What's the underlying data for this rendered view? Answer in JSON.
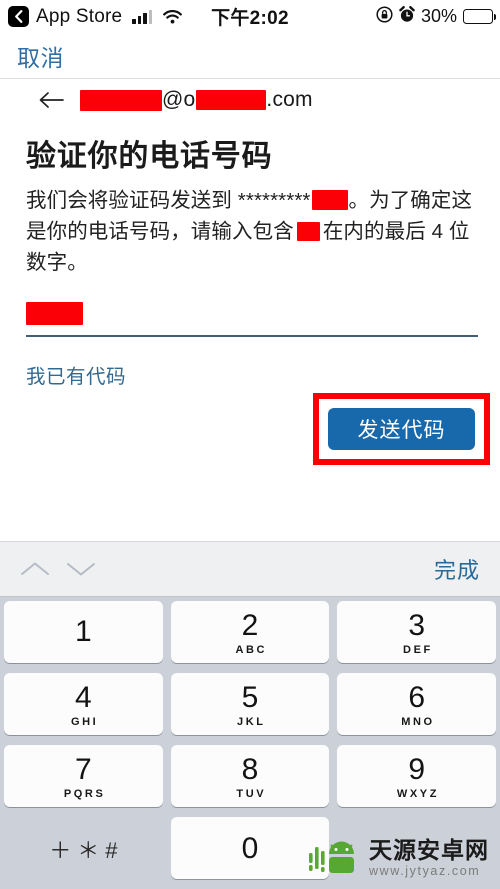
{
  "statusbar": {
    "back_icon": "chevron-left-icon",
    "carrier_app": "App Store",
    "signal_icon": "cellular-signal-icon",
    "wifi_icon": "wifi-icon",
    "time": "下午2:02",
    "rotation_lock_icon": "rotation-lock-icon",
    "alarm_icon": "alarm-clock-icon",
    "battery_percent": "30%",
    "battery_icon": "battery-icon",
    "battery_level": 30
  },
  "navbar": {
    "cancel_label": "取消"
  },
  "account": {
    "back_icon": "arrow-left-icon",
    "email_at": "@",
    "email_domain_visible": "o",
    "email_tld": ".com",
    "redaction_color": "#fb0007"
  },
  "page": {
    "title": "验证你的电话号码",
    "body_part1": "我们会将验证码发送到 *********",
    "body_part2": "。为了确定这是你的电话号码，请输入包含",
    "body_part3": "在内的最后 4 位数字。"
  },
  "field": {
    "name": "phone-last4-input",
    "value": "",
    "placeholder": ""
  },
  "links": {
    "have_code": "我已有代码"
  },
  "primary_button": {
    "label": "发送代码",
    "color": "#1769ac",
    "highlight_color": "#fb0007"
  },
  "keyboard": {
    "toolbar": {
      "prev_icon": "chevron-up-icon",
      "next_icon": "chevron-down-icon",
      "done_label": "完成"
    },
    "keys": [
      {
        "num": "1",
        "sub": ""
      },
      {
        "num": "2",
        "sub": "ABC"
      },
      {
        "num": "3",
        "sub": "DEF"
      },
      {
        "num": "4",
        "sub": "GHI"
      },
      {
        "num": "5",
        "sub": "JKL"
      },
      {
        "num": "6",
        "sub": "MNO"
      },
      {
        "num": "7",
        "sub": "PQRS"
      },
      {
        "num": "8",
        "sub": "TUV"
      },
      {
        "num": "9",
        "sub": "WXYZ"
      }
    ],
    "symbol_key": "＋＊#",
    "zero_key": "0"
  },
  "watermark": {
    "logo_icon": "android-robot-logo",
    "title": "天源安卓网",
    "url": "www.jytyaz.com"
  }
}
